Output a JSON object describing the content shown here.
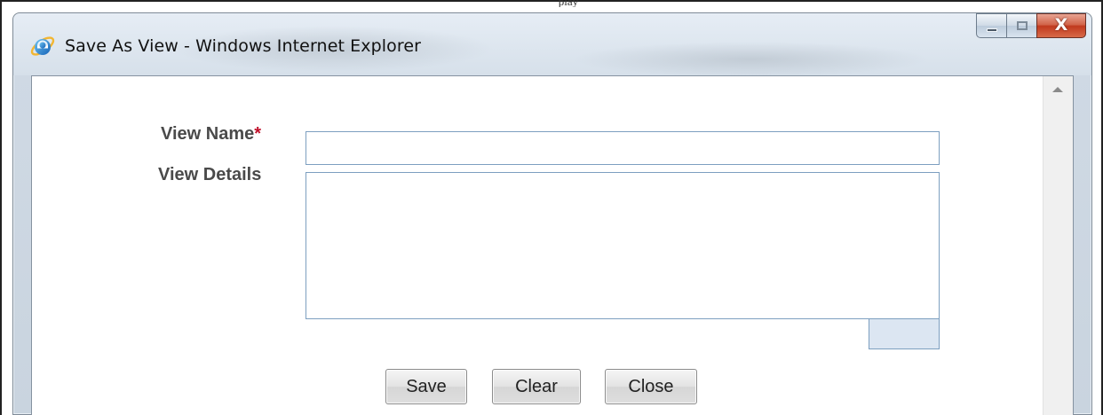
{
  "page": {
    "top_mark": "play"
  },
  "window": {
    "title": "Save As View - Windows Internet Explorer",
    "icon": "internet-explorer-icon",
    "controls": {
      "minimize_icon": "minimize-icon",
      "maximize_icon": "maximize-icon",
      "close_glyph": "X"
    }
  },
  "form": {
    "view_name_label": "View Name",
    "required_mark": "*",
    "view_name_value": "",
    "view_details_label": "View Details",
    "view_details_value": ""
  },
  "buttons": {
    "save": "Save",
    "clear": "Clear",
    "close": "Close"
  },
  "colors": {
    "required": "#c0102a",
    "close_button": "#c0391e",
    "input_border": "#7d9fc0"
  }
}
